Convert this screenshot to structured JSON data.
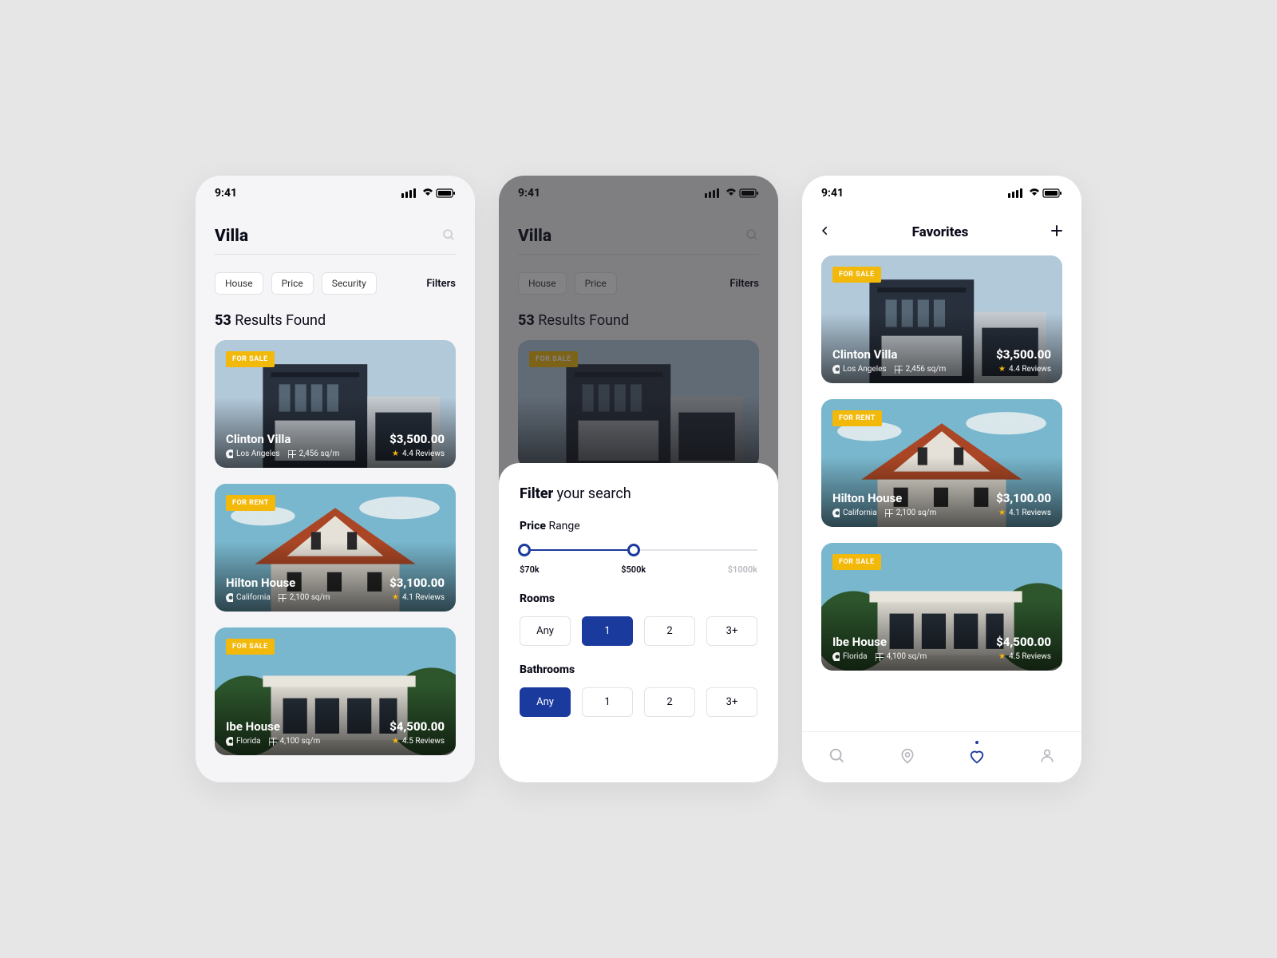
{
  "status": {
    "time": "9:41"
  },
  "screen1": {
    "search": "Villa",
    "chips": [
      "House",
      "Price",
      "Security"
    ],
    "filters_label": "Filters",
    "results_count": "53",
    "results_text": "Results Found"
  },
  "listings": [
    {
      "badge": "FOR SALE",
      "name": "Clinton Villa",
      "location": "Los Angeles",
      "area": "2,456 sq/m",
      "price": "$3,500.00",
      "rating": "4.4 Reviews"
    },
    {
      "badge": "FOR RENT",
      "name": "Hilton House",
      "location": "California",
      "area": "2,100 sq/m",
      "price": "$3,100.00",
      "rating": "4.1 Reviews"
    },
    {
      "badge": "FOR SALE",
      "name": "Ibe House",
      "location": "Florida",
      "area": "4,100 sq/m",
      "price": "$4,500.00",
      "rating": "4.5 Reviews"
    }
  ],
  "filter_sheet": {
    "title_bold": "Filter",
    "title_rest": "your search",
    "price_bold": "Price",
    "price_rest": "Range",
    "price_min": "$70k",
    "price_mid": "$500k",
    "price_max": "$1000k",
    "rooms_label": "Rooms",
    "rooms_options": [
      "Any",
      "1",
      "2",
      "3+"
    ],
    "rooms_selected": 1,
    "bath_label": "Bathrooms",
    "bath_options": [
      "Any",
      "1",
      "2",
      "3+"
    ],
    "bath_selected": 0
  },
  "screen3": {
    "title": "Favorites"
  }
}
